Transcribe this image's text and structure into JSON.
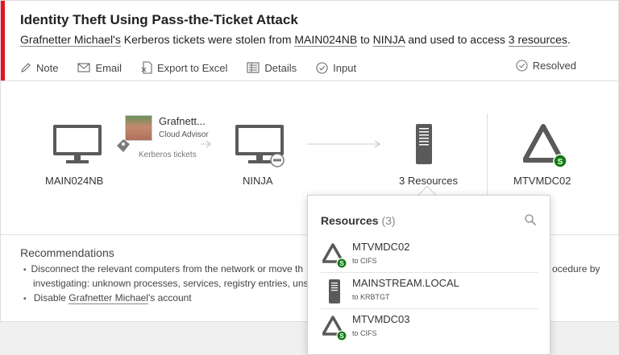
{
  "alert": {
    "title": "Identity Theft Using Pass-the-Ticket Attack",
    "subtitle": {
      "user": "Grafnetter Michael's",
      "t1": " Kerberos tickets were stolen from ",
      "source": "MAIN024NB",
      "t2": " to ",
      "dest": "NINJA",
      "t3": " and used to access ",
      "resources": "3 resources",
      "t4": "."
    },
    "accent_color": "#e81123"
  },
  "actions": [
    {
      "label": "Note",
      "icon": "pencil-icon"
    },
    {
      "label": "Email",
      "icon": "envelope-icon"
    },
    {
      "label": "Export to Excel",
      "icon": "excel-icon"
    },
    {
      "label": "Details",
      "icon": "details-icon"
    },
    {
      "label": "Input",
      "icon": "check-circle-icon"
    }
  ],
  "resolved_label": "Resolved",
  "graph": {
    "source_label": "MAIN024NB",
    "dest_label": "NINJA",
    "resources_label": "3 Resources",
    "dc_label": "MTVMDC02",
    "user_name": "Grafnett...",
    "user_role": "Cloud Advisor",
    "ticket_label": "Kerberos tickets"
  },
  "recommendations": {
    "title": "Recommendations",
    "item1": "Disconnect the relevant computers from the network or move th",
    "item1_right": "ocedure by",
    "item1_cont": "investigating: unknown processes, services, registry entries, unsig",
    "item2_pre": "Disable ",
    "item2_user": "Grafnetter Michael",
    "item2_post": "'s account"
  },
  "popup": {
    "title": "Resources",
    "count": "(3)",
    "items": [
      {
        "name": "MTVMDC02",
        "sub": "to CIFS",
        "icon": "domain-controller-icon"
      },
      {
        "name": "MAINSTREAM.LOCAL",
        "sub": "to KRBTGT",
        "icon": "server-icon"
      },
      {
        "name": "MTVMDC03",
        "sub": "to CIFS",
        "icon": "domain-controller-icon"
      }
    ]
  },
  "colors": {
    "badge_green": "#107c10",
    "icon_gray": "#555555"
  }
}
